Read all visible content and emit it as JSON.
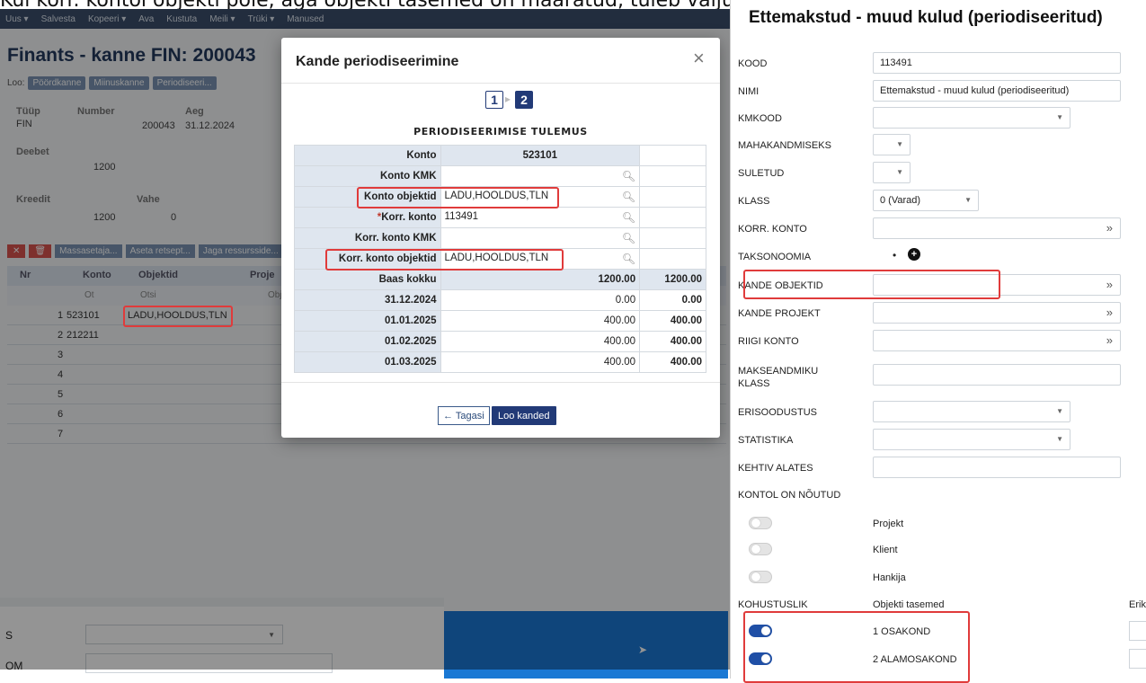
{
  "caption": "Kui korr. kontol objekti pole, aga objekti tasemed on määratud, tuleb valjule konto objekt:",
  "background": {
    "toolbar": [
      "Uus ▾",
      "Salvesta",
      "Kopeeri ▾",
      "Ava",
      "Kustuta",
      "Meili ▾",
      "Trüki ▾",
      "Manused"
    ],
    "title": "Finants - kanne FIN: 200043",
    "loo_label": "Loo:",
    "loo_buttons": [
      "Pöördkanne",
      "Miinuskanne",
      "Periodiseeri..."
    ],
    "fields": {
      "tyyp_label": "Tüüp",
      "tyyp": "FIN",
      "number_label": "Number",
      "number": "200043",
      "aeg_label": "Aeg",
      "aeg": "31.12.2024",
      "deebet_label": "Deebet",
      "deebet": "1200",
      "kreedit_label": "Kreedit",
      "kreedit": "1200",
      "vahe_label": "Vahe",
      "vahe": "0"
    },
    "grid_buttons": [
      "Massasetaja...",
      "Aseta retsept...",
      "Jaga ressursside..."
    ],
    "grid_headers": {
      "nr": "Nr",
      "konto": "Konto",
      "objektid": "Objektid",
      "projekt": "Proje"
    },
    "grid_filter": {
      "konto": "Ot",
      "objektid": "Otsi",
      "projekt": "Obj"
    },
    "rows": [
      {
        "nr": "1",
        "konto": "523101",
        "objektid": "LADU,HOOLDUS,TLN"
      },
      {
        "nr": "2",
        "konto": "212211",
        "objektid": ""
      },
      {
        "nr": "3",
        "konto": "",
        "objektid": ""
      },
      {
        "nr": "4",
        "konto": "",
        "objektid": ""
      },
      {
        "nr": "5",
        "konto": "",
        "objektid": ""
      },
      {
        "nr": "6",
        "konto": "",
        "objektid": ""
      },
      {
        "nr": "7",
        "konto": "",
        "objektid": ""
      }
    ],
    "lower_labels": [
      "S",
      "OM"
    ]
  },
  "modal": {
    "title": "Kande periodiseerimine",
    "close": "×",
    "step1": "1",
    "step2": "2",
    "subtitle": "PERIODISEERIMISE TULEMUS",
    "rows": {
      "konto": {
        "label": "Konto",
        "value": "523101"
      },
      "konto_kmk": {
        "label": "Konto KMK",
        "value": ""
      },
      "konto_objektid": {
        "label": "Konto objektid",
        "value": "LADU,HOOLDUS,TLN"
      },
      "korr_konto": {
        "req": "*",
        "label": "Korr. konto",
        "value": "113491"
      },
      "korr_konto_kmk": {
        "label": "Korr. konto KMK",
        "value": ""
      },
      "korr_konto_objektid": {
        "label": "Korr. konto objektid",
        "value": "LADU,HOOLDUS,TLN"
      },
      "baas": {
        "label": "Baas kokku",
        "value": "1200.00",
        "extra": "1200.00"
      }
    },
    "periods": [
      {
        "date": "31.12.2024",
        "value": "0.00",
        "extra": "0.00"
      },
      {
        "date": "01.01.2025",
        "value": "400.00",
        "extra": "400.00"
      },
      {
        "date": "01.02.2025",
        "value": "400.00",
        "extra": "400.00"
      },
      {
        "date": "01.03.2025",
        "value": "400.00",
        "extra": "400.00"
      }
    ],
    "back_button": "← Tagasi",
    "create_button": "Loo kanded"
  },
  "right_panel": {
    "title": "Ettemakstud - muud kulud (periodiseeritud)",
    "kood_label": "KOOD",
    "kood": "113491",
    "nimi_label": "NIMI",
    "nimi": "Ettemakstud - muud kulud (periodiseeritud)",
    "kmkood_label": "KMKOOD",
    "kmkood": "",
    "mahakandmiseks_label": "MAHAKANDMISEKS",
    "suletud_label": "SULETUD",
    "klass_label": "KLASS",
    "klass": "0 (Varad)",
    "korr_konto_label": "KORR. KONTO",
    "taksonoomia_label": "TAKSONOOMIA",
    "taksonoomia_dot": "•",
    "kande_objektid_label": "KANDE OBJEKTID",
    "kande_projekt_label": "KANDE PROJEKT",
    "riigi_konto_label": "RIIGI KONTO",
    "makseandmiku_label": "MAKSEANDMIKU KLASS",
    "erisoodustus_label": "ERISOODUSTUS",
    "statistika_label": "STATISTIKA",
    "kehtiv_label": "KEHTIV ALATES",
    "kontol_label": "KONTOL ON NÕUTUD",
    "toggles": [
      {
        "label": "Projekt",
        "on": false
      },
      {
        "label": "Klient",
        "on": false
      },
      {
        "label": "Hankija",
        "on": false
      }
    ],
    "kohustuslik_label": "KOHUSTUSLIK",
    "objekti_tasemed_label": "Objekti tasemed",
    "eriko_label": "Eriko",
    "levels": [
      {
        "label": "1 OSAKOND",
        "on": true
      },
      {
        "label": "2 ALAMOSAKOND",
        "on": true
      }
    ]
  },
  "colors": {
    "accent": "#223a77",
    "highlight": "#e03b3b",
    "toggle_on": "#1f4fa6"
  }
}
